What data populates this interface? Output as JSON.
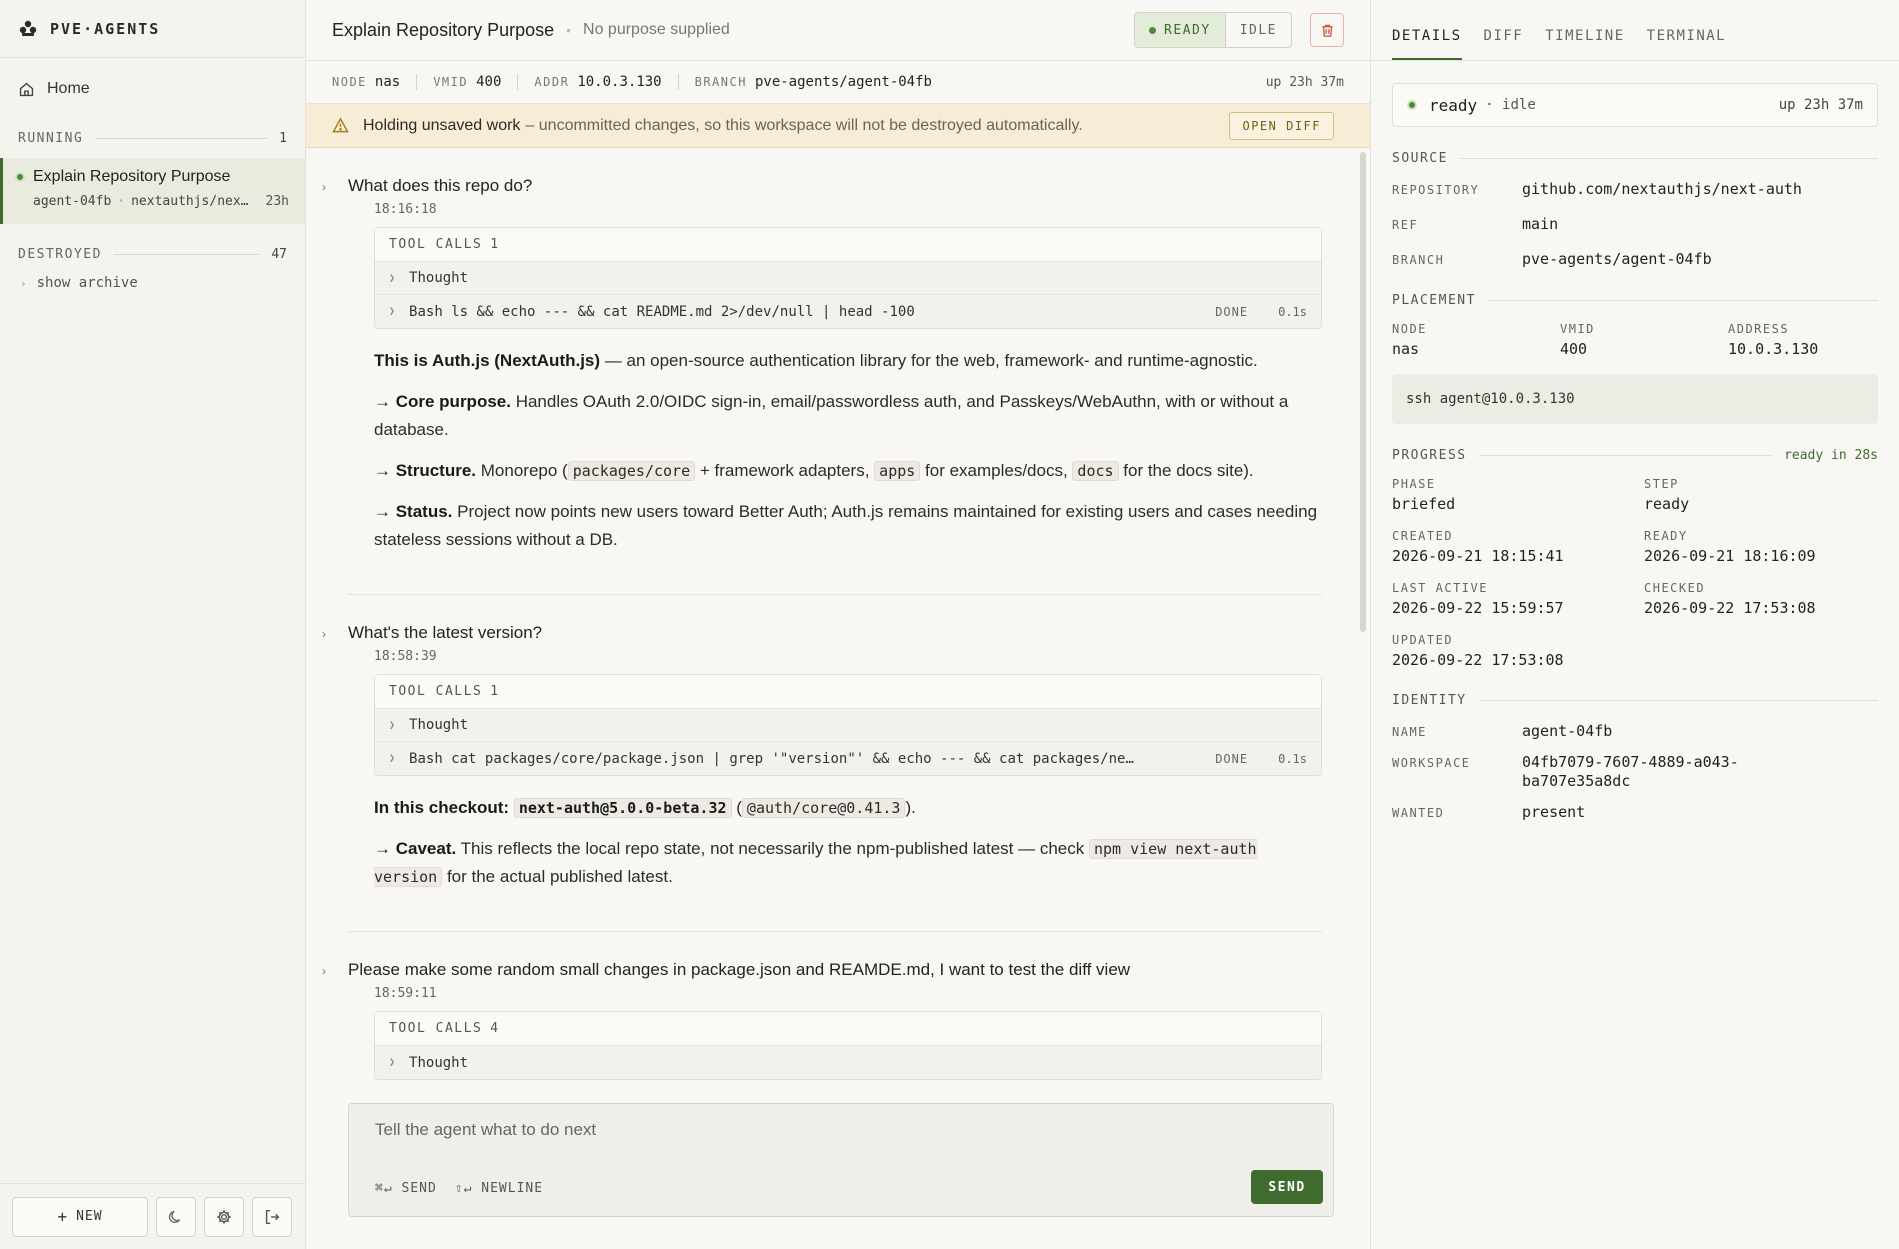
{
  "brand": {
    "name": "PVE·AGENTS"
  },
  "sidebar": {
    "home_label": "Home",
    "running": {
      "label": "RUNNING",
      "count": "1"
    },
    "agent": {
      "title": "Explain Repository Purpose",
      "id": "agent-04fb",
      "repo": "nextauthjs/nex…",
      "age": "23h"
    },
    "destroyed": {
      "label": "DESTROYED",
      "count": "47"
    },
    "show_archive": "show archive",
    "new_label": "NEW"
  },
  "header": {
    "title": "Explain Repository Purpose",
    "purpose": "No purpose supplied",
    "state_ready": "READY",
    "state_idle": "IDLE"
  },
  "infobar": {
    "node_k": "NODE",
    "node_v": "nas",
    "vmid_k": "VMID",
    "vmid_v": "400",
    "addr_k": "ADDR",
    "addr_v": "10.0.3.130",
    "branch_k": "BRANCH",
    "branch_v": "pve-agents/agent-04fb",
    "uptime": "up 23h 37m"
  },
  "warning": {
    "strong": "Holding unsaved work",
    "rest": "– uncommitted changes, so this workspace will not be destroyed automatically.",
    "button": "OPEN DIFF"
  },
  "thread": {
    "tool_calls_label": "TOOL CALLS",
    "turns": [
      {
        "question": "What does this repo do?",
        "time": "18:16:18",
        "tool_count": "1",
        "tools": [
          {
            "cmd": "Thought"
          },
          {
            "cmd": "Bash ls && echo --- && cat README.md 2>/dev/null | head -100",
            "status": "DONE",
            "time": "0.1s"
          }
        ],
        "a1_bold": "This is Auth.js (NextAuth.js)",
        "a1_rest": " — an open-source authentication library for the web, framework- and runtime-agnostic.",
        "a2_bold": "→ Core purpose.",
        "a2_rest": " Handles OAuth 2.0/OIDC sign-in, email/passwordless auth, and Passkeys/WebAuthn, with or without a database.",
        "a3_bold": "→ Structure.",
        "a3_t1": " Monorepo (",
        "a3_c1": "packages/core",
        "a3_t2": " + framework adapters, ",
        "a3_c2": "apps",
        "a3_t3": " for examples/docs, ",
        "a3_c3": "docs",
        "a3_t4": " for the docs site).",
        "a4_bold": "→ Status.",
        "a4_rest": " Project now points new users toward Better Auth; Auth.js remains maintained for existing users and cases needing stateless sessions without a DB."
      },
      {
        "question": "What's the latest version?",
        "time": "18:58:39",
        "tool_count": "1",
        "tools": [
          {
            "cmd": "Thought"
          },
          {
            "cmd": "Bash cat packages/core/package.json | grep '\"version\"' && echo --- && cat packages/ne…",
            "status": "DONE",
            "time": "0.1s"
          }
        ],
        "a1_bold": "In this checkout:",
        "a1_c1": "next-auth@5.0.0-beta.32",
        "a1_t1": " (",
        "a1_c2": "@auth/core@0.41.3",
        "a1_t2": ").",
        "a2_bold": "→ Caveat.",
        "a2_t1": " This reflects the local repo state, not necessarily the npm-published latest — check ",
        "a2_c1": "npm view next-auth version",
        "a2_t2": " for the actual published latest."
      },
      {
        "question": "Please make some random small changes in package.json and REAMDE.md, I want to test the diff view",
        "time": "18:59:11",
        "tool_count": "4",
        "tools": [
          {
            "cmd": "Thought"
          }
        ]
      }
    ]
  },
  "composer": {
    "placeholder": "Tell the agent what to do next",
    "hint_send": "⌘↵ SEND",
    "hint_newline": "⇧↵ NEWLINE",
    "send": "SEND"
  },
  "right": {
    "tabs": [
      "DETAILS",
      "DIFF",
      "TIMELINE",
      "TERMINAL"
    ],
    "status": {
      "state": "ready",
      "sub": "· idle",
      "uptime": "up 23h 37m"
    },
    "source": {
      "label": "SOURCE",
      "repository_k": "REPOSITORY",
      "repository_v": "github.com/nextauthjs/next-auth",
      "ref_k": "REF",
      "ref_v": "main",
      "branch_k": "BRANCH",
      "branch_v": "pve-agents/agent-04fb"
    },
    "placement": {
      "label": "PLACEMENT",
      "node_k": "NODE",
      "node_v": "nas",
      "vmid_k": "VMID",
      "vmid_v": "400",
      "address_k": "ADDRESS",
      "address_v": "10.0.3.130",
      "ssh": "ssh agent@10.0.3.130"
    },
    "progress": {
      "label": "PROGRESS",
      "ready_in": "ready in 28s",
      "phase_k": "PHASE",
      "phase_v": "briefed",
      "step_k": "STEP",
      "step_v": "ready",
      "created_k": "CREATED",
      "created_v": "2026-09-21 18:15:41",
      "ready_k": "READY",
      "ready_v": "2026-09-21 18:16:09",
      "last_active_k": "LAST ACTIVE",
      "last_active_v": "2026-09-22 15:59:57",
      "checked_k": "CHECKED",
      "checked_v": "2026-09-22 17:53:08",
      "updated_k": "UPDATED",
      "updated_v": "2026-09-22 17:53:08"
    },
    "identity": {
      "label": "IDENTITY",
      "name_k": "NAME",
      "name_v": "agent-04fb",
      "workspace_k": "WORKSPACE",
      "workspace_v1": "04fb7079-7607-4889-a043-",
      "workspace_v2": "ba707e35a8dc",
      "wanted_k": "WANTED",
      "wanted_v": "present"
    }
  },
  "colors": {
    "accent": "#3f6b2f",
    "ready_dot": "#4c8a3a",
    "warning_bg": "#f7ecd6",
    "danger": "#c8564a"
  }
}
